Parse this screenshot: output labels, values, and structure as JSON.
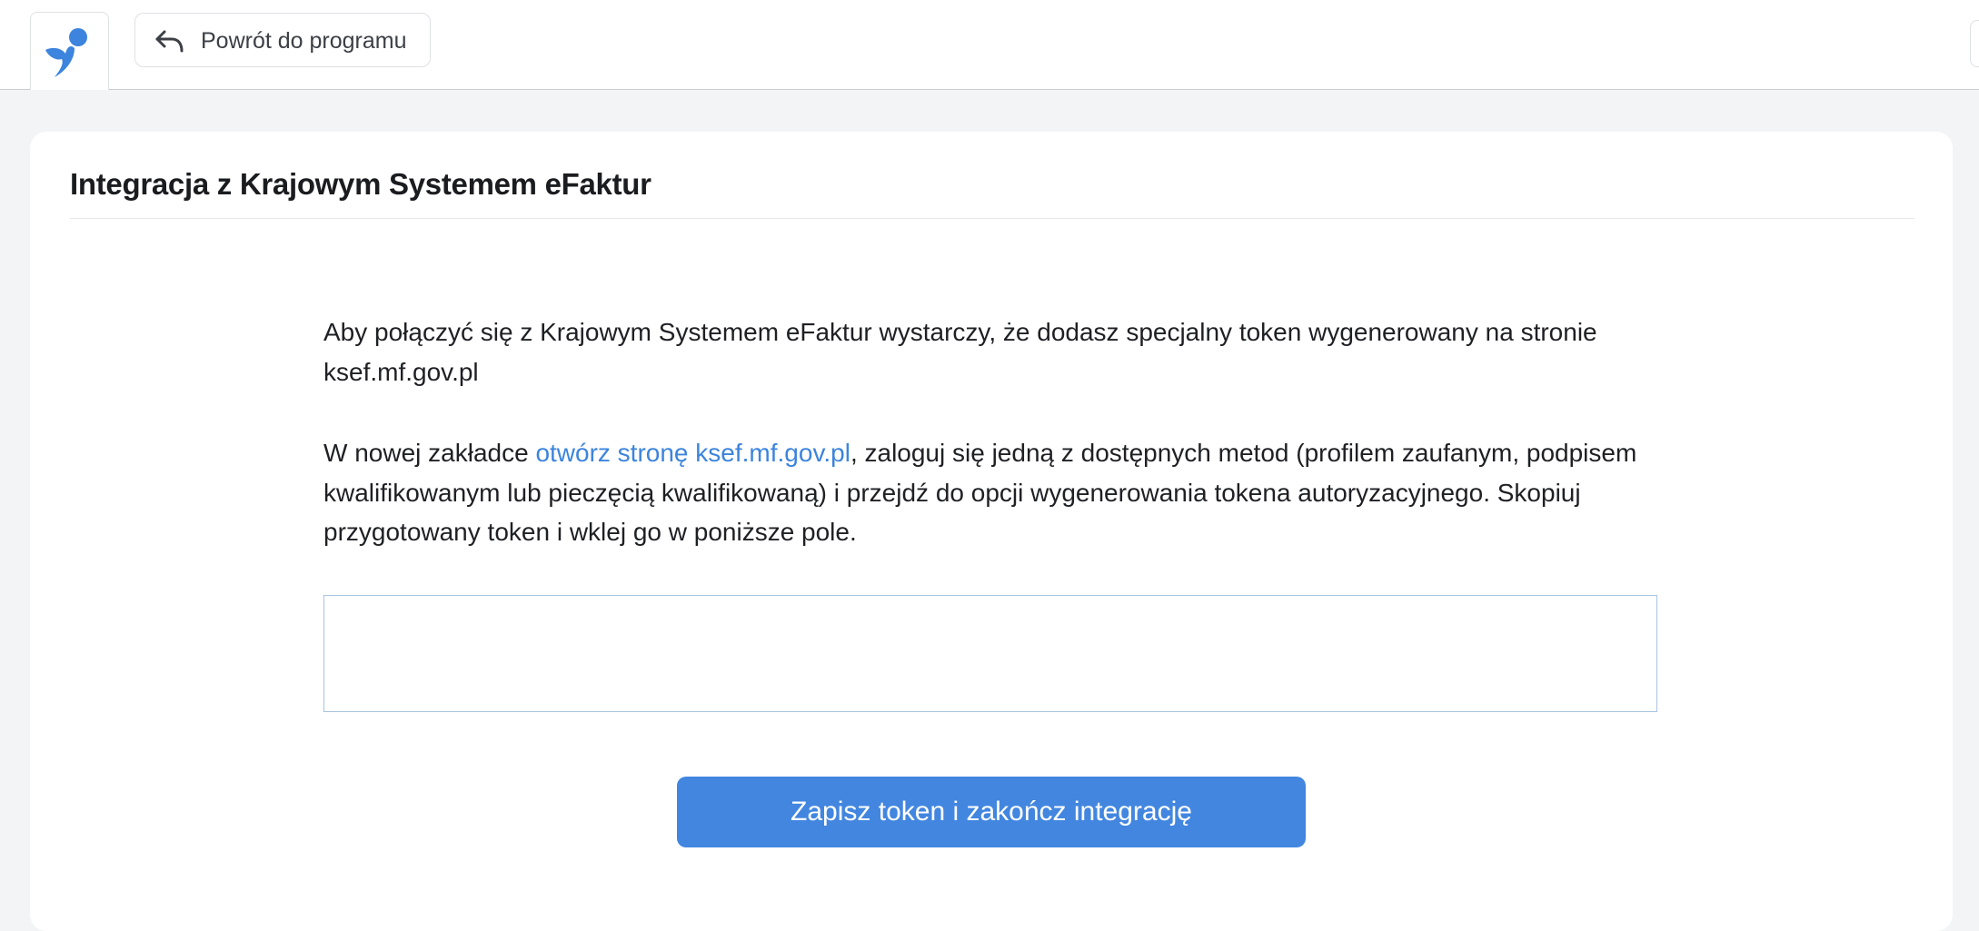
{
  "header": {
    "back_label": "Powrót do programu",
    "brand_color": "#3c84dd"
  },
  "card": {
    "title": "Integracja z Krajowym Systemem eFaktur",
    "intro_text": "Aby połączyć się z Krajowym Systemem eFaktur wystarczy, że dodasz specjalny token wygenerowany na stronie ksef.mf.gov.pl",
    "instruction_prefix": "W nowej zakładce ",
    "instruction_link": "otwórz stronę ksef.mf.gov.pl",
    "instruction_suffix": ", zaloguj się jedną z dostępnych metod (profilem zaufanym, podpisem kwalifikowanym lub pieczęcią kwalifikowaną) i przejdź do opcji wygenerowania tokena autoryzacyjnego. Skopiuj przygotowany token i wklej go w poniższe pole.",
    "token_value": "",
    "save_label": "Zapisz token i zakończ integrację",
    "accent_color": "#4286e0"
  }
}
